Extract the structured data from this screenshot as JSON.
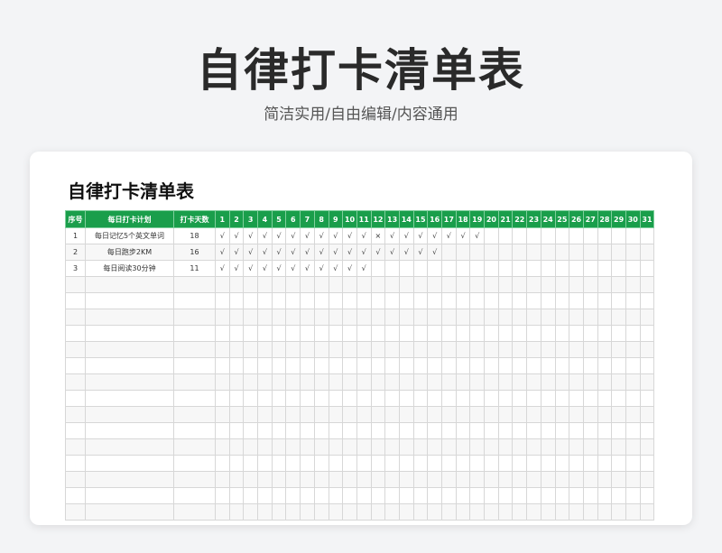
{
  "hero": {
    "title": "自律打卡清单表",
    "subtitle": "简洁实用/自由编辑/内容通用"
  },
  "sheet": {
    "title": "自律打卡清单表",
    "headers": {
      "index": "序号",
      "plan": "每日打卡计划",
      "days": "打卡天数",
      "day_numbers": [
        "1",
        "2",
        "3",
        "4",
        "5",
        "6",
        "7",
        "8",
        "9",
        "10",
        "11",
        "12",
        "13",
        "14",
        "15",
        "16",
        "17",
        "18",
        "19",
        "20",
        "21",
        "22",
        "23",
        "24",
        "25",
        "26",
        "27",
        "28",
        "29",
        "30",
        "31"
      ]
    },
    "rows": [
      {
        "index": "1",
        "plan": "每日记忆5个英文单词",
        "days": "18",
        "marks": [
          "√",
          "√",
          "√",
          "√",
          "√",
          "√",
          "√",
          "√",
          "√",
          "√",
          "√",
          "×",
          "√",
          "√",
          "√",
          "√",
          "√",
          "√",
          "√",
          "",
          "",
          "",
          "",
          "",
          "",
          "",
          "",
          "",
          "",
          "",
          ""
        ]
      },
      {
        "index": "2",
        "plan": "每日跑步2KM",
        "days": "16",
        "marks": [
          "√",
          "√",
          "√",
          "√",
          "√",
          "√",
          "√",
          "√",
          "√",
          "√",
          "√",
          "√",
          "√",
          "√",
          "√",
          "√",
          "",
          "",
          "",
          "",
          "",
          "",
          "",
          "",
          "",
          "",
          "",
          "",
          "",
          "",
          ""
        ]
      },
      {
        "index": "3",
        "plan": "每日阅读30分钟",
        "days": "11",
        "marks": [
          "√",
          "√",
          "√",
          "√",
          "√",
          "√",
          "√",
          "√",
          "√",
          "√",
          "√",
          "",
          "",
          "",
          "",
          "",
          "",
          "",
          "",
          "",
          "",
          "",
          "",
          "",
          "",
          "",
          "",
          "",
          "",
          "",
          ""
        ]
      }
    ],
    "empty_row_count": 15
  }
}
